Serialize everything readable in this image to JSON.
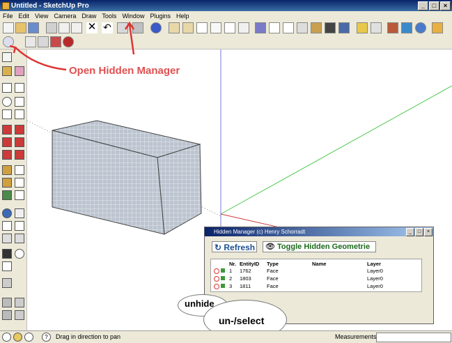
{
  "window": {
    "title": "Untitled - SketchUp Pro"
  },
  "menu": [
    "File",
    "Edit",
    "View",
    "Camera",
    "Draw",
    "Tools",
    "Window",
    "Plugins",
    "Help"
  ],
  "annotations": {
    "open_hidden_manager": "Open Hidden Manager",
    "unhide": "unhide",
    "unselect": "un-/select"
  },
  "hidden_manager": {
    "title": "Hidden Manager (c) Henry Schorradt",
    "refresh_label": "Refresh",
    "toggle_label": "Toggle Hidden Geometrie",
    "columns": {
      "nr": "Nr.",
      "entity_id": "EntityID",
      "type": "Type",
      "name": "Name",
      "layer": "Layer"
    },
    "rows": [
      {
        "nr": "1",
        "entity_id": "1762",
        "type": "Face",
        "name": "",
        "layer": "Layer0"
      },
      {
        "nr": "2",
        "entity_id": "1803",
        "type": "Face",
        "name": "",
        "layer": "Layer0"
      },
      {
        "nr": "3",
        "entity_id": "1811",
        "type": "Face",
        "name": "",
        "layer": "Layer0"
      }
    ]
  },
  "status": {
    "hint": "Drag in direction to pan",
    "measurements_label": "Measurements",
    "measurements_value": ""
  },
  "colors": {
    "titlebar": "#0a246a",
    "annotation": "#e05050",
    "green_axis": "#4cc84c",
    "red_axis": "#cc3b3b"
  }
}
